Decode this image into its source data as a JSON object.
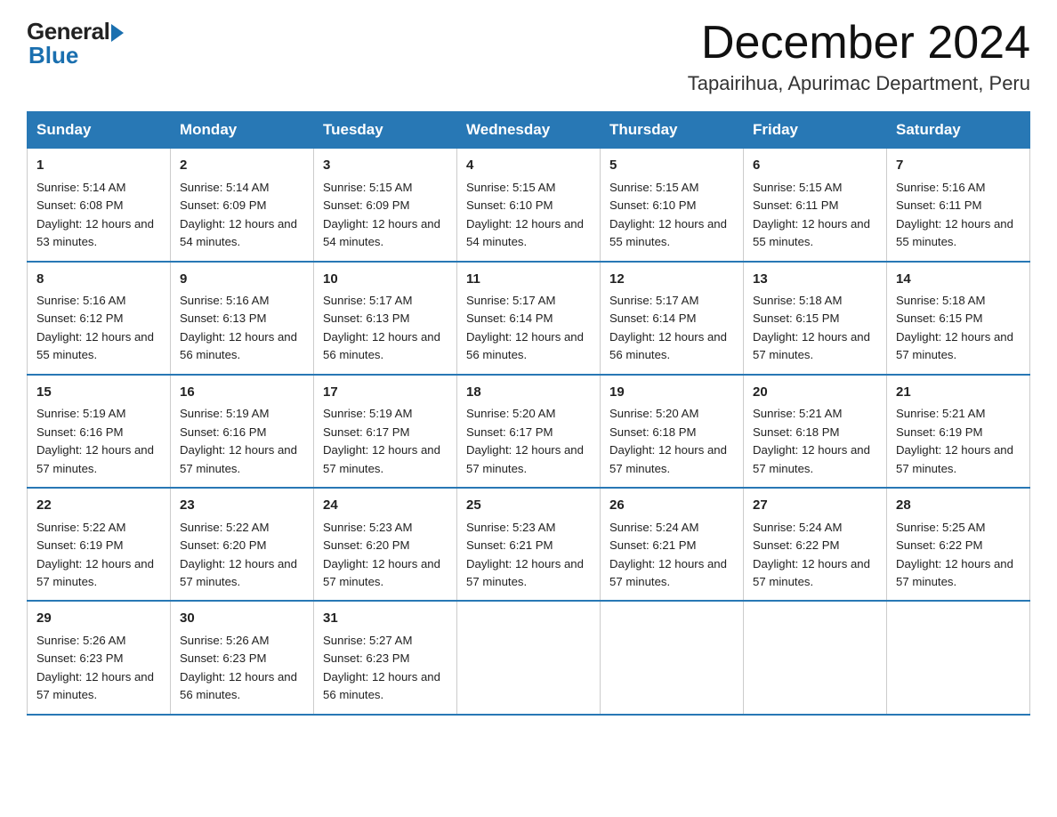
{
  "logo": {
    "general": "General",
    "blue": "Blue"
  },
  "title": "December 2024",
  "location": "Tapairihua, Apurimac Department, Peru",
  "days_of_week": [
    "Sunday",
    "Monday",
    "Tuesday",
    "Wednesday",
    "Thursday",
    "Friday",
    "Saturday"
  ],
  "weeks": [
    [
      {
        "day": "1",
        "sunrise": "5:14 AM",
        "sunset": "6:08 PM",
        "daylight": "12 hours and 53 minutes."
      },
      {
        "day": "2",
        "sunrise": "5:14 AM",
        "sunset": "6:09 PM",
        "daylight": "12 hours and 54 minutes."
      },
      {
        "day": "3",
        "sunrise": "5:15 AM",
        "sunset": "6:09 PM",
        "daylight": "12 hours and 54 minutes."
      },
      {
        "day": "4",
        "sunrise": "5:15 AM",
        "sunset": "6:10 PM",
        "daylight": "12 hours and 54 minutes."
      },
      {
        "day": "5",
        "sunrise": "5:15 AM",
        "sunset": "6:10 PM",
        "daylight": "12 hours and 55 minutes."
      },
      {
        "day": "6",
        "sunrise": "5:15 AM",
        "sunset": "6:11 PM",
        "daylight": "12 hours and 55 minutes."
      },
      {
        "day": "7",
        "sunrise": "5:16 AM",
        "sunset": "6:11 PM",
        "daylight": "12 hours and 55 minutes."
      }
    ],
    [
      {
        "day": "8",
        "sunrise": "5:16 AM",
        "sunset": "6:12 PM",
        "daylight": "12 hours and 55 minutes."
      },
      {
        "day": "9",
        "sunrise": "5:16 AM",
        "sunset": "6:13 PM",
        "daylight": "12 hours and 56 minutes."
      },
      {
        "day": "10",
        "sunrise": "5:17 AM",
        "sunset": "6:13 PM",
        "daylight": "12 hours and 56 minutes."
      },
      {
        "day": "11",
        "sunrise": "5:17 AM",
        "sunset": "6:14 PM",
        "daylight": "12 hours and 56 minutes."
      },
      {
        "day": "12",
        "sunrise": "5:17 AM",
        "sunset": "6:14 PM",
        "daylight": "12 hours and 56 minutes."
      },
      {
        "day": "13",
        "sunrise": "5:18 AM",
        "sunset": "6:15 PM",
        "daylight": "12 hours and 57 minutes."
      },
      {
        "day": "14",
        "sunrise": "5:18 AM",
        "sunset": "6:15 PM",
        "daylight": "12 hours and 57 minutes."
      }
    ],
    [
      {
        "day": "15",
        "sunrise": "5:19 AM",
        "sunset": "6:16 PM",
        "daylight": "12 hours and 57 minutes."
      },
      {
        "day": "16",
        "sunrise": "5:19 AM",
        "sunset": "6:16 PM",
        "daylight": "12 hours and 57 minutes."
      },
      {
        "day": "17",
        "sunrise": "5:19 AM",
        "sunset": "6:17 PM",
        "daylight": "12 hours and 57 minutes."
      },
      {
        "day": "18",
        "sunrise": "5:20 AM",
        "sunset": "6:17 PM",
        "daylight": "12 hours and 57 minutes."
      },
      {
        "day": "19",
        "sunrise": "5:20 AM",
        "sunset": "6:18 PM",
        "daylight": "12 hours and 57 minutes."
      },
      {
        "day": "20",
        "sunrise": "5:21 AM",
        "sunset": "6:18 PM",
        "daylight": "12 hours and 57 minutes."
      },
      {
        "day": "21",
        "sunrise": "5:21 AM",
        "sunset": "6:19 PM",
        "daylight": "12 hours and 57 minutes."
      }
    ],
    [
      {
        "day": "22",
        "sunrise": "5:22 AM",
        "sunset": "6:19 PM",
        "daylight": "12 hours and 57 minutes."
      },
      {
        "day": "23",
        "sunrise": "5:22 AM",
        "sunset": "6:20 PM",
        "daylight": "12 hours and 57 minutes."
      },
      {
        "day": "24",
        "sunrise": "5:23 AM",
        "sunset": "6:20 PM",
        "daylight": "12 hours and 57 minutes."
      },
      {
        "day": "25",
        "sunrise": "5:23 AM",
        "sunset": "6:21 PM",
        "daylight": "12 hours and 57 minutes."
      },
      {
        "day": "26",
        "sunrise": "5:24 AM",
        "sunset": "6:21 PM",
        "daylight": "12 hours and 57 minutes."
      },
      {
        "day": "27",
        "sunrise": "5:24 AM",
        "sunset": "6:22 PM",
        "daylight": "12 hours and 57 minutes."
      },
      {
        "day": "28",
        "sunrise": "5:25 AM",
        "sunset": "6:22 PM",
        "daylight": "12 hours and 57 minutes."
      }
    ],
    [
      {
        "day": "29",
        "sunrise": "5:26 AM",
        "sunset": "6:23 PM",
        "daylight": "12 hours and 57 minutes."
      },
      {
        "day": "30",
        "sunrise": "5:26 AM",
        "sunset": "6:23 PM",
        "daylight": "12 hours and 56 minutes."
      },
      {
        "day": "31",
        "sunrise": "5:27 AM",
        "sunset": "6:23 PM",
        "daylight": "12 hours and 56 minutes."
      },
      null,
      null,
      null,
      null
    ]
  ]
}
